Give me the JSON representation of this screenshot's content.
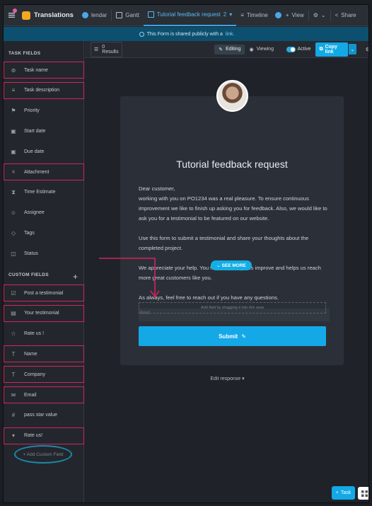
{
  "app": {
    "title": "Translations"
  },
  "tabs": [
    {
      "label": "lendar"
    },
    {
      "label": "Gantt"
    },
    {
      "label": "Tutorial feedback request",
      "count": "2",
      "active": true
    },
    {
      "label": "Timeline"
    },
    {
      "label": "View"
    }
  ],
  "header_actions": {
    "share": "Share"
  },
  "banner": {
    "text": "This Form is shared publicly with a",
    "link": "link."
  },
  "sidebar": {
    "task_fields_heading": "TASK FIELDS",
    "task_fields": [
      {
        "label": "Task name",
        "icon": "task-name-icon",
        "highlighted": true
      },
      {
        "label": "Task description",
        "icon": "description-icon",
        "highlighted": true
      },
      {
        "label": "Priority",
        "icon": "flag-icon",
        "highlighted": false
      },
      {
        "label": "Start date",
        "icon": "calendar-icon",
        "highlighted": false
      },
      {
        "label": "Due date",
        "icon": "calendar-icon",
        "highlighted": false
      },
      {
        "label": "Attachment",
        "icon": "paperclip-icon",
        "highlighted": true
      },
      {
        "label": "Time Estimate",
        "icon": "hourglass-icon",
        "highlighted": false
      },
      {
        "label": "Assignee",
        "icon": "user-icon",
        "highlighted": false
      },
      {
        "label": "Tags",
        "icon": "tag-icon",
        "highlighted": false
      },
      {
        "label": "Status",
        "icon": "status-icon",
        "highlighted": false
      }
    ],
    "custom_fields_heading": "CUSTOM FIELDS",
    "custom_fields": [
      {
        "label": "Post a testimonial",
        "icon": "checkbox-icon",
        "highlighted": true
      },
      {
        "label": "Your testimonial",
        "icon": "text-area-icon",
        "highlighted": true
      },
      {
        "label": "Rate us !",
        "icon": "star-icon",
        "highlighted": false
      },
      {
        "label": "Name",
        "icon": "text-icon",
        "highlighted": true
      },
      {
        "label": "Company",
        "icon": "text-icon",
        "highlighted": true
      },
      {
        "label": "Email",
        "icon": "email-icon",
        "highlighted": true
      },
      {
        "label": "pass star value",
        "icon": "hash-icon",
        "highlighted": false
      },
      {
        "label": "Rate us!",
        "icon": "dropdown-icon",
        "highlighted": true
      }
    ],
    "add_custom_field": "+ Add Custom Field"
  },
  "toolbar": {
    "results": "0 Results",
    "editing": "Editing",
    "viewing": "Viewing",
    "active": "Active",
    "copy_link": "Copy link"
  },
  "form": {
    "title": "Tutorial feedback request",
    "paragraphs": [
      "Dear customer,\nworking with you on PO1234 was a real pleasure. To ensure continuous improvement we like to finish up asking you for feedback. Also, we would like to ask you for a testimonial to be featured on our website.",
      "Use this form to submit a testimonial and share your thoughts about the completed project.",
      "We appreciate your help. You feedback helps us improve and helps us reach more great customers like you.",
      "As always, feel free to reach out if you have any questions."
    ],
    "faded_text": "Best",
    "see_more": "SEE MORE",
    "dropzone": "Add field by dragging it into this area",
    "submit": "Submit",
    "edit_response": "Edit response"
  },
  "floating": {
    "task": "Task"
  },
  "colors": {
    "accent": "#15a8e7",
    "highlight": "#d3245c",
    "ring": "#1a8aa8"
  }
}
